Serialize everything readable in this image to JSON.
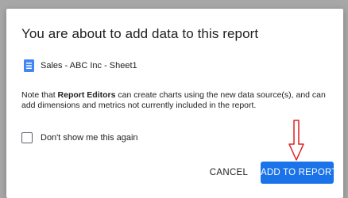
{
  "dialog": {
    "title": "You are about to add data to this report",
    "source": {
      "icon": "google-sheets-icon",
      "label": "Sales - ABC Inc - Sheet1"
    },
    "note": {
      "prefix": "Note that ",
      "emphasis": "Report Editors",
      "suffix": " can create charts using the new data source(s), and can add dimensions and metrics not currently included in the report."
    },
    "dont_show_again": {
      "label": "Don't show me this again",
      "checked": false
    },
    "buttons": {
      "cancel": "CANCEL",
      "add": "ADD TO REPORT"
    }
  },
  "annotation": {
    "icon": "red-arrow-down-icon",
    "color": "#e02020"
  },
  "colors": {
    "primary": "#1a73e8",
    "sheets_icon": "#4285f4",
    "backdrop": "#a7a7a7"
  }
}
